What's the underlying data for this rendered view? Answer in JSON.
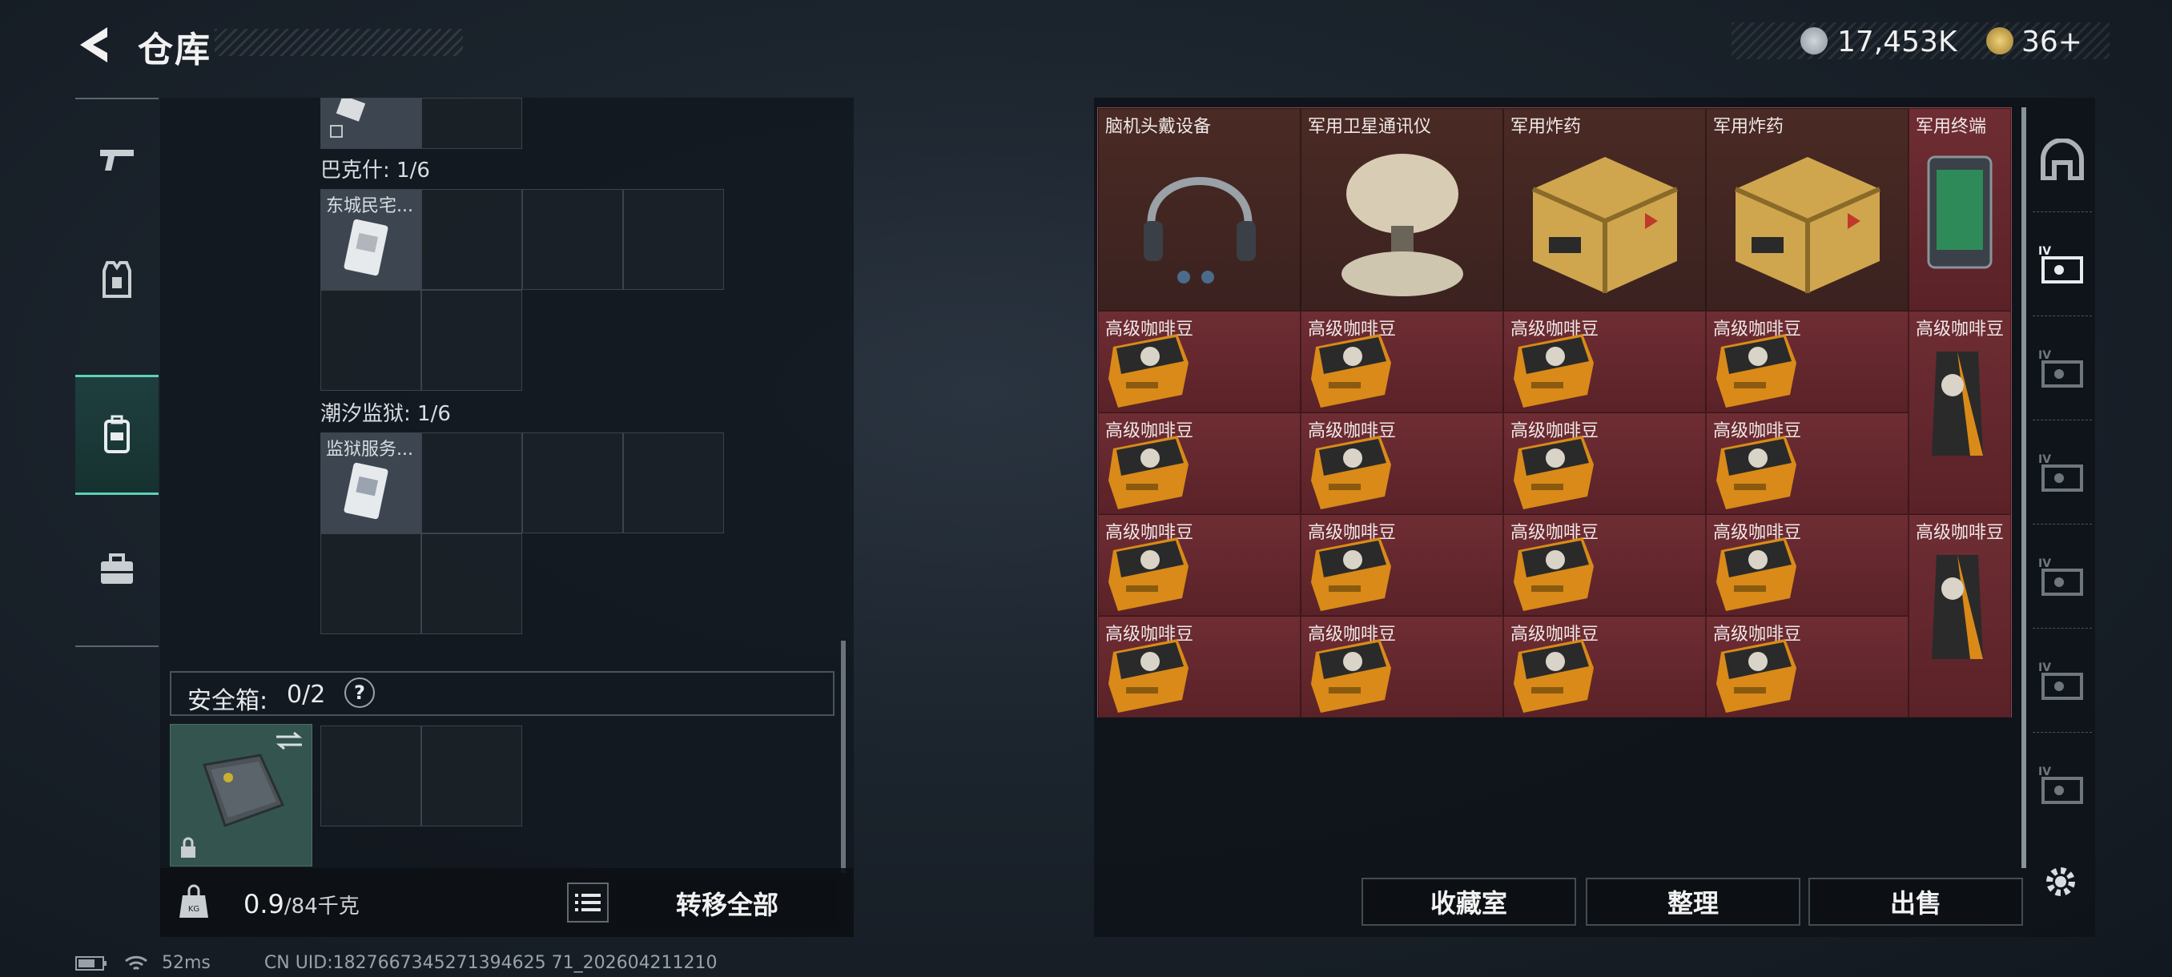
{
  "header": {
    "title": "仓库"
  },
  "currency": {
    "coins": "17,453K",
    "tickets": "36+"
  },
  "left_tabs": [
    {
      "name": "weapon-tab",
      "icon": "gun-icon"
    },
    {
      "name": "armor-tab",
      "icon": "vest-icon"
    },
    {
      "name": "backpack-tab",
      "icon": "backpack-icon",
      "active": true
    },
    {
      "name": "case-tab",
      "icon": "toolbox-icon"
    }
  ],
  "sections": {
    "bakeshi": {
      "label": "巴克什: 1/6",
      "item_label": "东城民宅..."
    },
    "chaoxi": {
      "label": "潮汐监狱: 1/6",
      "item_label": "监狱服务..."
    }
  },
  "safe_box": {
    "label": "安全箱:",
    "count": "0/2",
    "help": "?"
  },
  "bottom": {
    "weight_value": "0.9",
    "weight_capacity": "/84千克",
    "transfer_all": "转移全部"
  },
  "grid_items": {
    "row0": [
      "脑机头戴设备",
      "军用卫星通讯仪",
      "军用炸药",
      "军用炸药",
      "军用终端"
    ],
    "coffee": "高级咖啡豆"
  },
  "buttons": {
    "collection": "收藏室",
    "organize": "整理",
    "sell": "出售"
  },
  "status": {
    "ping": "52ms",
    "uid": "CN UID:1827667345271394625 71_202604211210"
  }
}
